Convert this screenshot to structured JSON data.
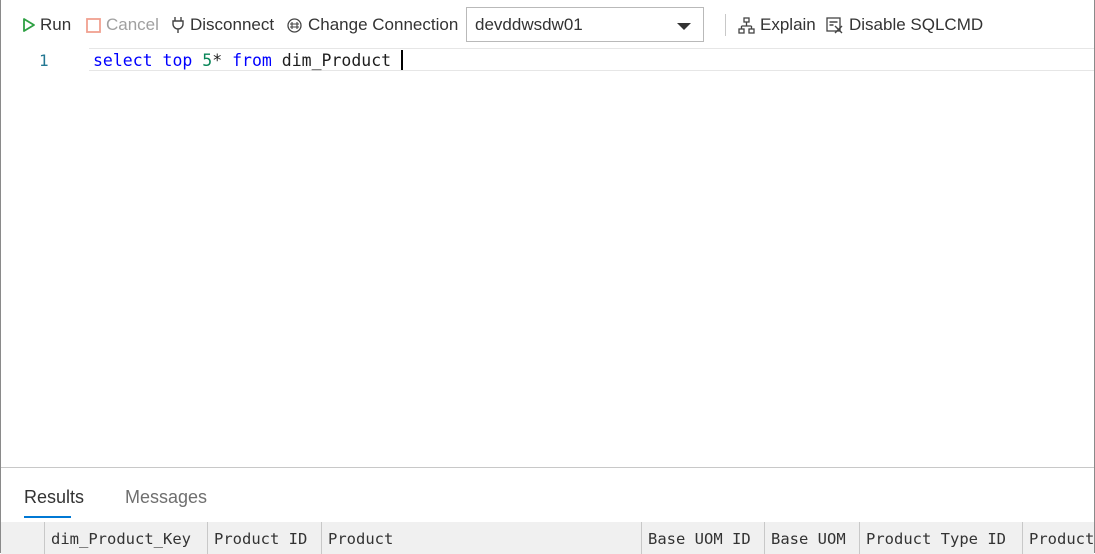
{
  "toolbar": {
    "run_label": "Run",
    "cancel_label": "Cancel",
    "disconnect_label": "Disconnect",
    "change_connection_label": "Change Connection",
    "connection": "devddwsdw01",
    "explain_label": "Explain",
    "disable_sqlcmd_label": "Disable SQLCMD"
  },
  "editor": {
    "line_number": "1",
    "tokens": {
      "kw_select": "select",
      "kw_top": "top",
      "num": "5",
      "star": "*",
      "kw_from": "from",
      "table": "dim_Product"
    }
  },
  "results": {
    "tabs": [
      "Results",
      "Messages"
    ],
    "columns": [
      "dim_Product_Key",
      "Product ID",
      "Product",
      "Base UOM ID",
      "Base UOM",
      "Product Type ID",
      "Product"
    ]
  },
  "colors": {
    "run_icon": "#2ea043",
    "cancel_icon": "#f0a090",
    "keyword": "#0000ff",
    "number": "#098658",
    "line_number": "#237893",
    "tab_underline": "#0078d4"
  }
}
